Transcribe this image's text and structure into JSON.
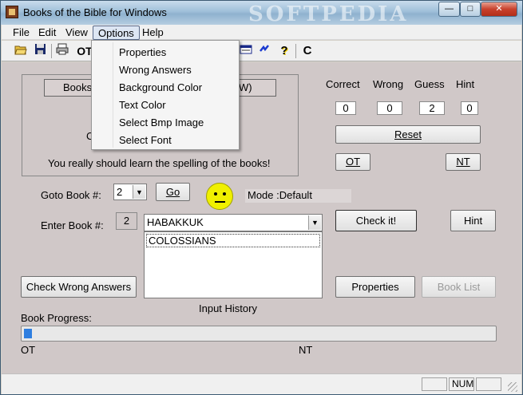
{
  "window": {
    "title": "Books of the Bible for Windows",
    "watermark": "SOFTPEDIA",
    "controls": {
      "minimize": "—",
      "maximize": "□",
      "close": "✕"
    }
  },
  "menu": {
    "items": [
      "File",
      "Edit",
      "View",
      "Options",
      "Help"
    ],
    "active": "Options",
    "options_items": [
      "Properties",
      "Wrong Answers",
      "Background Color",
      "Text Color",
      "Select Bmp Image",
      "Select Font"
    ]
  },
  "toolbar": {
    "ot_label": "OT",
    "cl_label": "C",
    "help_glyph": "?"
  },
  "quiz": {
    "tab_books": "Books",
    "tab_right": "W)",
    "partial_c": "C",
    "message": "You really should learn the spelling of the books!"
  },
  "scores": {
    "headers": [
      "Correct",
      "Wrong",
      "Guess",
      "Hint"
    ],
    "values": [
      "0",
      "0",
      "2",
      "0"
    ],
    "reset_label": "Reset",
    "ot_label": "OT",
    "nt_label": "NT"
  },
  "goto": {
    "label": "Goto Book #:",
    "value": "2",
    "go_label": "Go",
    "mode_label": "Mode :Default"
  },
  "enter": {
    "label": "Enter Book #:",
    "number": "2",
    "book_value": "HABAKKUK",
    "check_label": "Check it!",
    "hint_label": "Hint"
  },
  "history": {
    "items": [
      "COLOSSIANS"
    ],
    "label": "Input History"
  },
  "buttons": {
    "check_wrong": "Check Wrong Answers",
    "properties": "Properties",
    "book_list": "Book List"
  },
  "progress": {
    "label": "Book Progress:",
    "value_percent": 1.7,
    "ot_label": "OT",
    "nt_label": "NT"
  },
  "statusbar": {
    "num": "NUM"
  },
  "colors": {
    "content_bg": "#d0c8c8",
    "progress_fill": "#2f7fe0",
    "smiley": "#f0f000"
  }
}
